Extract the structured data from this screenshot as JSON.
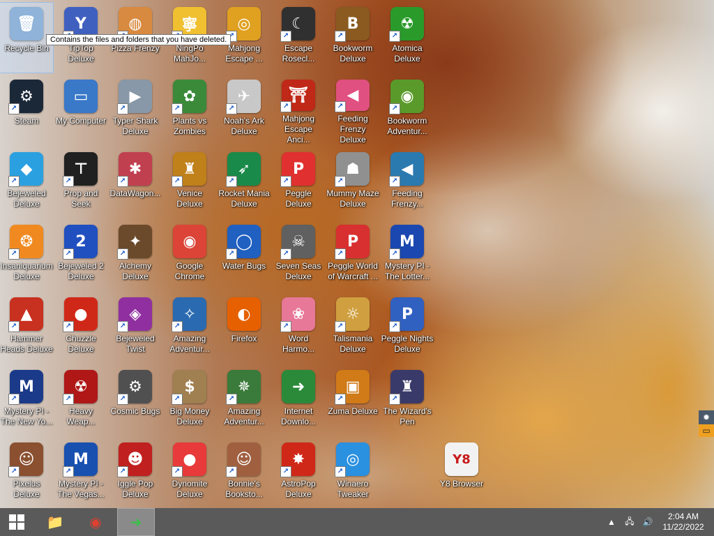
{
  "tooltip": "Contains the files and folders that you have deleted.",
  "desktop_icons": [
    {
      "label": "Recycle Bin",
      "icon": "recycle-bin-icon",
      "color": "#8fb3d9",
      "glyph": "🗑",
      "shortcut": false
    },
    {
      "label": "Steam",
      "icon": "steam-icon",
      "color": "#1b2838",
      "glyph": "⚙",
      "shortcut": true
    },
    {
      "label": "Bejeweled Deluxe",
      "icon": "diamond-icon",
      "color": "#2aa0e0",
      "glyph": "◆",
      "shortcut": true
    },
    {
      "label": "Insaniquarium Deluxe",
      "icon": "goldfish-icon",
      "color": "#f08a20",
      "glyph": "❂",
      "shortcut": true
    },
    {
      "label": "Hammer Heads Deluxe",
      "icon": "gnome-icon",
      "color": "#c83020",
      "glyph": "▲",
      "shortcut": true
    },
    {
      "label": "Mystery PI - The New Yo...",
      "icon": "mpi-badge-icon",
      "color": "#1c3a8a",
      "glyph": "M",
      "shortcut": true
    },
    {
      "label": "Pixelus Deluxe",
      "icon": "pixelus-icon",
      "color": "#8a5030",
      "glyph": "☺",
      "shortcut": true
    },
    {
      "label": "TipTop Deluxe",
      "icon": "cocktail-icon",
      "color": "#4060c0",
      "glyph": "Y",
      "shortcut": true
    },
    {
      "label": "My Computer",
      "icon": "computer-icon",
      "color": "#3a78c8",
      "glyph": "▭",
      "shortcut": false
    },
    {
      "label": "Prop and Seek",
      "icon": "prop-seek-icon",
      "color": "#202020",
      "glyph": "⊤",
      "shortcut": true
    },
    {
      "label": "Bejeweled 2 Deluxe",
      "icon": "bejeweled-2-icon",
      "color": "#2050c0",
      "glyph": "2",
      "shortcut": true
    },
    {
      "label": "Chuzzle Deluxe",
      "icon": "chuzzle-icon",
      "color": "#d02818",
      "glyph": "●",
      "shortcut": true
    },
    {
      "label": "Heavy Weap...",
      "icon": "radiation-icon",
      "color": "#b01818",
      "glyph": "☢",
      "shortcut": true
    },
    {
      "label": "Mystery PI - The Vegas...",
      "icon": "mpi-vegas-icon",
      "color": "#1850b0",
      "glyph": "M",
      "shortcut": true
    },
    {
      "label": "Pizza Frenzy",
      "icon": "pizza-icon",
      "color": "#d88a40",
      "glyph": "◍",
      "shortcut": true
    },
    {
      "label": "Typer Shark Deluxe",
      "icon": "shark-icon",
      "color": "#8898a8",
      "glyph": "▶",
      "shortcut": true
    },
    {
      "label": "DataWagon...",
      "icon": "datawagon-icon",
      "color": "#c04050",
      "glyph": "✱",
      "shortcut": true
    },
    {
      "label": "Alchemy Deluxe",
      "icon": "wizard-icon",
      "color": "#6a4a2a",
      "glyph": "✦",
      "shortcut": true
    },
    {
      "label": "Bejeweled Twist",
      "icon": "gem-twist-icon",
      "color": "#9030a0",
      "glyph": "◈",
      "shortcut": true
    },
    {
      "label": "Cosmic Bugs",
      "icon": "gear-icon",
      "color": "#505050",
      "glyph": "⚙",
      "shortcut": true
    },
    {
      "label": "Iggle Pop Deluxe",
      "icon": "iggle-icon",
      "color": "#c02020",
      "glyph": "☻",
      "shortcut": true
    },
    {
      "label": "NingPo MahJo...",
      "icon": "mahjong-tile-icon",
      "color": "#f0c030",
      "glyph": "寧",
      "shortcut": true
    },
    {
      "label": "Plants vs Zombies",
      "icon": "zombie-plant-icon",
      "color": "#3a8a3a",
      "glyph": "✿",
      "shortcut": true
    },
    {
      "label": "Venice Deluxe",
      "icon": "gondola-icon",
      "color": "#c0801a",
      "glyph": "♜",
      "shortcut": true
    },
    {
      "label": "Google Chrome",
      "icon": "chrome-icon",
      "color": "#db4437",
      "glyph": "◉",
      "shortcut": false
    },
    {
      "label": "Amazing Adventur...",
      "icon": "compass-gem-icon",
      "color": "#2a6ab0",
      "glyph": "✧",
      "shortcut": true
    },
    {
      "label": "Big Money Deluxe",
      "icon": "money-bag-icon",
      "color": "#a08050",
      "glyph": "$",
      "shortcut": true
    },
    {
      "label": "Dynomite Deluxe",
      "icon": "egg-icon",
      "color": "#e83a3a",
      "glyph": "●",
      "shortcut": true
    },
    {
      "label": "Mahjong Escape ...",
      "icon": "mahjong-escape-icon",
      "color": "#e0a020",
      "glyph": "◎",
      "shortcut": true
    },
    {
      "label": "Noah's Ark Deluxe",
      "icon": "dove-icon",
      "color": "#c8c8c8",
      "glyph": "✈",
      "shortcut": true
    },
    {
      "label": "Rocket Mania Deluxe",
      "icon": "rocket-icon",
      "color": "#1a8a4a",
      "glyph": "➶",
      "shortcut": true
    },
    {
      "label": "Water Bugs",
      "icon": "porthole-icon",
      "color": "#2060c0",
      "glyph": "◯",
      "shortcut": true
    },
    {
      "label": "Firefox",
      "icon": "firefox-icon",
      "color": "#e66000",
      "glyph": "◐",
      "shortcut": false
    },
    {
      "label": "Amazing Adventur...",
      "icon": "compass-icon",
      "color": "#3a7a3a",
      "glyph": "✵",
      "shortcut": true
    },
    {
      "label": "Bonnie's Booksto...",
      "icon": "bonnie-icon",
      "color": "#a06040",
      "glyph": "☺",
      "shortcut": true
    },
    {
      "label": "Escape Rosecl...",
      "icon": "moon-icon",
      "color": "#303030",
      "glyph": "☾",
      "shortcut": true
    },
    {
      "label": "Mahjong Escape Anci...",
      "icon": "torii-gate-icon",
      "color": "#c02818",
      "glyph": "⛩",
      "shortcut": true
    },
    {
      "label": "Peggle Deluxe",
      "icon": "peggle-icon",
      "color": "#e03030",
      "glyph": "P",
      "shortcut": true
    },
    {
      "label": "Seven Seas Deluxe",
      "icon": "skull-icon",
      "color": "#606060",
      "glyph": "☠",
      "shortcut": true
    },
    {
      "label": "Word Harmo...",
      "icon": "flower-icon",
      "color": "#e87898",
      "glyph": "❀",
      "shortcut": true
    },
    {
      "label": "Internet Downlo...",
      "icon": "download-globe-icon",
      "color": "#2a8a3a",
      "glyph": "➜",
      "shortcut": false
    },
    {
      "label": "AstroPop Deluxe",
      "icon": "astropop-icon",
      "color": "#d02818",
      "glyph": "✸",
      "shortcut": true
    },
    {
      "label": "Bookworm Deluxe",
      "icon": "book-icon",
      "color": "#8a5a20",
      "glyph": "B",
      "shortcut": true
    },
    {
      "label": "Feeding Frenzy Deluxe",
      "icon": "fish-icon",
      "color": "#e05080",
      "glyph": "◀",
      "shortcut": true
    },
    {
      "label": "Mummy Maze Deluxe",
      "icon": "mummy-icon",
      "color": "#909090",
      "glyph": "☗",
      "shortcut": true
    },
    {
      "label": "Peggle World of Warcraft ...",
      "icon": "peggle-wow-icon",
      "color": "#d83030",
      "glyph": "P",
      "shortcut": true
    },
    {
      "label": "Talismania Deluxe",
      "icon": "talisman-icon",
      "color": "#d0a040",
      "glyph": "☼",
      "shortcut": true
    },
    {
      "label": "Zuma Deluxe",
      "icon": "zuma-icon",
      "color": "#d07a18",
      "glyph": "▣",
      "shortcut": true
    },
    {
      "label": "Winaero Tweaker",
      "icon": "winaero-icon",
      "color": "#2a90e0",
      "glyph": "◎",
      "shortcut": true
    },
    {
      "label": "Atomica Deluxe",
      "icon": "atomica-icon",
      "color": "#2a9a2a",
      "glyph": "☢",
      "shortcut": true
    },
    {
      "label": "Bookworm Adventur...",
      "icon": "bookworm-icon",
      "color": "#5a9a2a",
      "glyph": "◉",
      "shortcut": true
    },
    {
      "label": "Feeding Frenzy...",
      "icon": "fish-2-icon",
      "color": "#2a7ab0",
      "glyph": "◀",
      "shortcut": true
    },
    {
      "label": "Mystery PI - The Lotter...",
      "icon": "mpi-lottery-icon",
      "color": "#1a48b0",
      "glyph": "M",
      "shortcut": true
    },
    {
      "label": "Peggle Nights Deluxe",
      "icon": "peggle-nights-icon",
      "color": "#3060c0",
      "glyph": "P",
      "shortcut": true
    },
    {
      "label": "The Wizard's Pen",
      "icon": "wizard-pen-icon",
      "color": "#3a3a6a",
      "glyph": "♜",
      "shortcut": true
    },
    {
      "label": "Y8 Browser",
      "icon": "y8-icon",
      "color": "#f2f2f2",
      "glyph": "Y8",
      "shortcut": false
    }
  ],
  "taskbar": {
    "apps": [
      {
        "name": "file-explorer-button",
        "icon": "folder-icon",
        "glyph": "📁",
        "active": false
      },
      {
        "name": "chrome-taskbar-button",
        "icon": "chrome-icon",
        "glyph": "◉",
        "active": false
      },
      {
        "name": "internet-download-manager-button",
        "icon": "download-globe-icon",
        "glyph": "➜",
        "active": true
      }
    ]
  },
  "tray": {
    "time": "2:04 AM",
    "date": "11/22/2022"
  }
}
